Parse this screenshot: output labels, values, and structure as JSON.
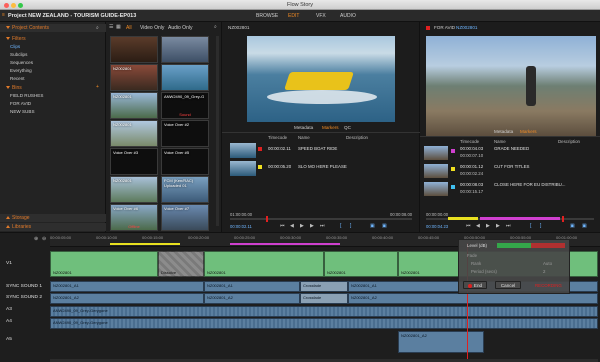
{
  "window": {
    "title": "Flow Story"
  },
  "topbar": {
    "project_title": "Project NEW ZEALAND - TOURISM GUIDE-EP013",
    "tabs": [
      {
        "label": "BROWSE"
      },
      {
        "label": "EDIT",
        "active": true
      },
      {
        "label": "VFX"
      },
      {
        "label": "AUDIO"
      }
    ]
  },
  "left_panel": {
    "project_contents_label": "Project Contents",
    "filters_label": "Filters",
    "filters": [
      "Clips",
      "Subclips",
      "Sequences",
      "Everything",
      "Recent"
    ],
    "bins_label": "Bins",
    "bins": [
      "FIELD RUSHES",
      "FOR AVID",
      "NEW SUBS"
    ],
    "storage_label": "Storage",
    "libraries_label": "Libraries"
  },
  "bin": {
    "tabs": [
      "All",
      "Video Only",
      "Audio Only"
    ],
    "thumbs": [
      {
        "label": "",
        "sub": ""
      },
      {
        "label": "",
        "sub": ""
      },
      {
        "label": "NZ002801",
        "sub": ""
      },
      {
        "label": "",
        "sub": ""
      },
      {
        "label": "NZ002801",
        "sub": ""
      },
      {
        "label": "ANW2490_09_Grey-G",
        "sub": "Sound"
      },
      {
        "label": "NZ002801",
        "sub": ""
      },
      {
        "label": "Voice Over #2",
        "sub": ""
      },
      {
        "label": "Voice Over #3",
        "sub": ""
      },
      {
        "label": "Voice Over #5",
        "sub": ""
      },
      {
        "label": "NZ002801",
        "sub": ""
      },
      {
        "label": "FCM (Ken/RAC) Uploaded 01",
        "sub": ""
      },
      {
        "label": "Voice Over #6",
        "sub": "Offline"
      },
      {
        "label": "Voice Over #7",
        "sub": ""
      }
    ]
  },
  "viewer_a": {
    "clip_name": "NZ002801",
    "tabs": [
      "Metadata",
      "Markers",
      "QC"
    ],
    "columns": [
      "Timecode",
      "Name",
      "Description"
    ],
    "markers": [
      {
        "timecode": "00:00:02.11",
        "name": "SPEED BOAT RIDE",
        "color": "#e02020"
      },
      {
        "timecode": "00:00:05.20",
        "name": "SLO MO HERE PLEASE",
        "color": "#f0e020"
      }
    ],
    "timecode_start": "01:00:00.00",
    "timecode_end": "00:00:08.00",
    "current": "00:00:02.11"
  },
  "viewer_b": {
    "label": "FOR AVID",
    "clip_name": "NZ002801",
    "tabs": [
      "Metadata",
      "Markers"
    ],
    "columns": [
      "Timecode",
      "Name",
      "Description"
    ],
    "markers": [
      {
        "timecode": "00:00:04.03",
        "end": "00:00:07.10",
        "name": "GRADE NEEDED",
        "color": "#d040d0"
      },
      {
        "timecode": "00:00:01.12",
        "end": "00:00:02.24",
        "name": "CUT FOR TITLES",
        "color": "#f0e020"
      },
      {
        "timecode": "00:00:08.03",
        "end": "00:00:15.17",
        "name": "CLOSE HERE FOR EU DISTRIBU...",
        "color": "#40c0f0"
      }
    ],
    "timecode_start": "00:00:00.00",
    "current": "00:00:04.23"
  },
  "timeline": {
    "ruler": [
      "00:00:05:00",
      "00:00:10:00",
      "00:00:15:00",
      "00:00:20:00",
      "00:00:25:00",
      "00:00:30:00",
      "00:00:35:00",
      "00:00:40:00",
      "00:00:45:00",
      "00:00:50:00",
      "00:00:55:00",
      "00:01:00:00"
    ],
    "tracks": [
      {
        "label": "V1"
      },
      {
        "label": "SYNC SOUND 1"
      },
      {
        "label": "SYNC SOUND 2"
      },
      {
        "label": "A3"
      },
      {
        "label": "A4"
      },
      {
        "label": "A5"
      }
    ],
    "video_clips": [
      {
        "label": "NZ002801",
        "color": "#6fbf7c"
      },
      {
        "label": "Dissolve",
        "color": "#8c8c8c"
      },
      {
        "label": "NZ002801",
        "color": "#6fbf7c"
      },
      {
        "label": "NZ002801",
        "color": "#6fbf7c"
      },
      {
        "label": "NZ002801",
        "color": "#6fbf7c"
      }
    ],
    "audio_labels": {
      "ss1": [
        "NZ002801_A1",
        "NZ002801_A1",
        "Crossfade",
        "NZ002801_A1"
      ],
      "ss2": [
        "NZ002801_A2",
        "NZ002801_A2",
        "Crossfade",
        "NZ002801_A2"
      ],
      "a3": "ANW2490_09_Grey-Gerygone",
      "a4": "ANW2490_09_Grey-Gerygone",
      "a5": "NZ002801_A2"
    },
    "popup": {
      "level_label": "Level (dB)",
      "rows": [
        "Fade",
        "Rank",
        "Period (secs)"
      ],
      "rank_value": "Auto",
      "period_value": "2",
      "end_label": "End",
      "cancel_label": "Cancel",
      "record_label": "RECORDING"
    }
  }
}
